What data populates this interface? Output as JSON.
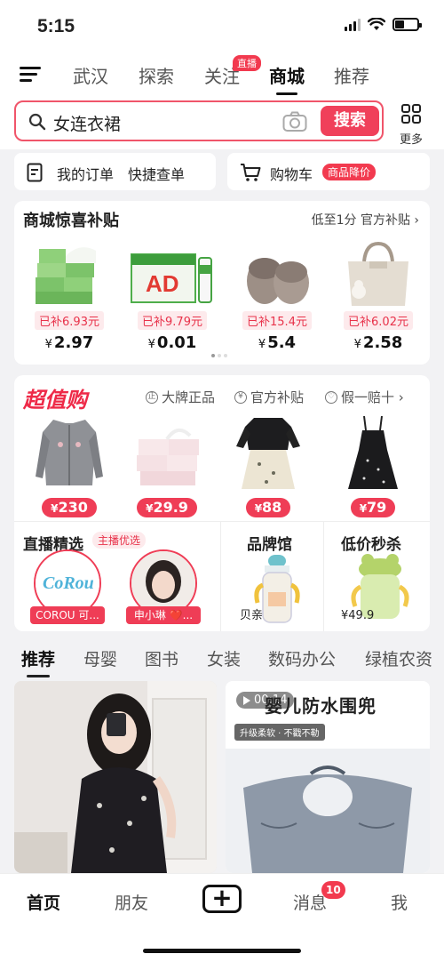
{
  "status": {
    "time": "5:15"
  },
  "nav": {
    "tabs": [
      {
        "label": "武汉"
      },
      {
        "label": "探索"
      },
      {
        "label": "关注",
        "badge": "直播"
      },
      {
        "label": "商城",
        "active": true
      },
      {
        "label": "推荐"
      }
    ]
  },
  "search": {
    "query": "女连衣裙",
    "button": "搜索",
    "more": "更多"
  },
  "quick": {
    "orders": "我的订单",
    "quick_check": "快捷查单",
    "cart": "购物车",
    "cart_badge": "商品降价"
  },
  "subsidy": {
    "title": "商城惊喜补贴",
    "more": "低至1分  官方补贴 ›",
    "items": [
      {
        "name": "tissue",
        "tag": "已补6.93元",
        "currency": "¥",
        "price": "2.97"
      },
      {
        "name": "ad-milk-drink",
        "tag": "已补9.79元",
        "currency": "¥",
        "price": "0.01"
      },
      {
        "name": "slippers",
        "tag": "已补15.4元",
        "currency": "¥",
        "price": "5.4"
      },
      {
        "name": "handbag",
        "tag": "已补6.02元",
        "currency": "¥",
        "price": "2.58"
      }
    ]
  },
  "deal": {
    "logo": "超值购",
    "features": [
      "大牌正品",
      "官方补贴",
      "假一赔十 ›"
    ],
    "items": [
      {
        "name": "cardigan",
        "currency": "¥",
        "price": "230"
      },
      {
        "name": "tissue-pack",
        "currency": "¥",
        "price": "29.9"
      },
      {
        "name": "two-piece-dress",
        "currency": "¥",
        "price": "88"
      },
      {
        "name": "slip-dress",
        "currency": "¥",
        "price": "79"
      }
    ],
    "live_title": "直播精选",
    "live_badge": "主播优选",
    "anchors": [
      {
        "name": "COROU 可...",
        "logo": "CoRou"
      },
      {
        "name": "申小琳 ❤️..."
      }
    ],
    "brand_title": "品牌馆",
    "brand_item": "贝亲",
    "flash_title": "低价秒杀",
    "flash_price": "¥49.9"
  },
  "categories": [
    "推荐",
    "母婴",
    "图书",
    "女装",
    "数码办公",
    "绿植农资"
  ],
  "feed": {
    "right": {
      "duration": "00:14",
      "headline": "婴儿防水围兜",
      "sub": "升级柔软 · 不戳不勒"
    }
  },
  "tabbar": {
    "home": "首页",
    "friends": "朋友",
    "plus": "+",
    "messages": "消息",
    "messages_badge": "10",
    "me": "我"
  }
}
